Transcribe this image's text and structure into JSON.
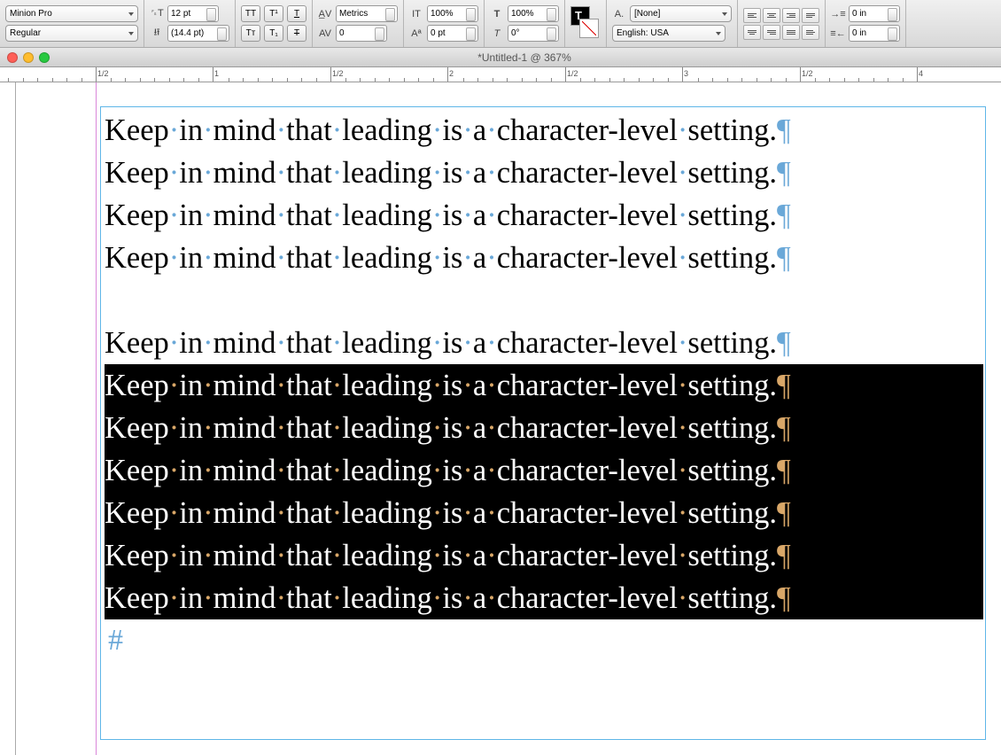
{
  "toolbar": {
    "font_family": "Minion Pro",
    "font_style": "Regular",
    "font_size": "12 pt",
    "leading": "(14.4 pt)",
    "kerning_mode": "Metrics",
    "tracking": "0",
    "vscale": "100%",
    "hscale": "100%",
    "baseline_shift": "0 pt",
    "skew": "0°",
    "char_style": "[None]",
    "language": "English: USA",
    "indent_left": "0 in",
    "indent_right": "0 in",
    "typecase": {
      "allcaps": "TT",
      "smallcaps": "Tᴛ",
      "super": "T¹",
      "sub": "T₁",
      "underline": "T",
      "strike": "T"
    }
  },
  "window": {
    "title": "*Untitled-1 @ 367%"
  },
  "ruler": {
    "marks": [
      "1/2",
      "1",
      "1/2",
      "2",
      "1/2",
      "3",
      "1/2",
      "4"
    ]
  },
  "document": {
    "lines_normal": [
      "Keep in mind that leading is a character-level setting.",
      "Keep in mind that leading is a character-level setting.",
      "Keep in mind that leading is a character-level setting.",
      "Keep in mind that leading is a character-level setting."
    ],
    "line_before_selection": "Keep in mind that leading is a character-level setting.",
    "lines_selected": [
      "Keep in mind that leading is a character-level setting.",
      "Keep in mind that leading is a character-level setting.",
      "Keep in mind that leading is a character-level setting.",
      "Keep in mind that leading is a character-level setting.",
      "Keep in mind that leading is a character-level setting.",
      "Keep in mind that leading is a character-level setting."
    ],
    "end_marker": "#"
  }
}
